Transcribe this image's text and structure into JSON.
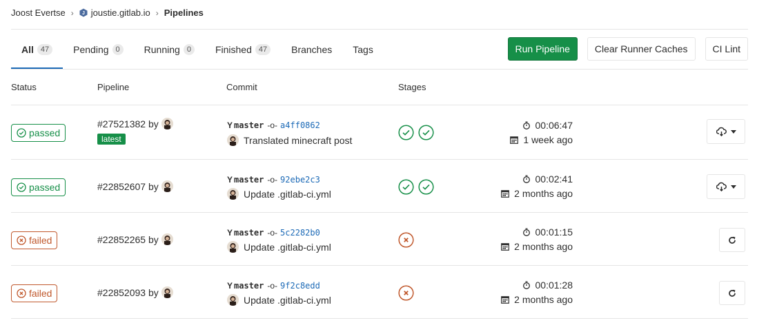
{
  "breadcrumb": {
    "user": "Joost Evertse",
    "project": "joustie.gitlab.io",
    "current": "Pipelines"
  },
  "tabs": [
    {
      "label": "All",
      "count": "47"
    },
    {
      "label": "Pending",
      "count": "0"
    },
    {
      "label": "Running",
      "count": "0"
    },
    {
      "label": "Finished",
      "count": "47"
    },
    {
      "label": "Branches"
    },
    {
      "label": "Tags"
    }
  ],
  "actions": {
    "run": "Run Pipeline",
    "clear": "Clear Runner Caches",
    "lint": "CI Lint"
  },
  "table": {
    "headers": [
      "Status",
      "Pipeline",
      "Commit",
      "Stages"
    ]
  },
  "rows": [
    {
      "status": "passed",
      "pipeline": "#27521382 by",
      "latest": "latest",
      "branch": "master",
      "sha": "a4ff0862",
      "message": "Translated minecraft post",
      "duration": "00:06:47",
      "finished": "1 week ago"
    },
    {
      "status": "passed",
      "pipeline": "#22852607 by",
      "branch": "master",
      "sha": "92ebe2c3",
      "message": "Update .gitlab-ci.yml",
      "duration": "00:02:41",
      "finished": "2 months ago"
    },
    {
      "status": "failed",
      "pipeline": "#22852265 by",
      "branch": "master",
      "sha": "5c2282b0",
      "message": "Update .gitlab-ci.yml",
      "duration": "00:01:15",
      "finished": "2 months ago"
    },
    {
      "status": "failed",
      "pipeline": "#22852093 by",
      "branch": "master",
      "sha": "9f2c8edd",
      "message": "Update .gitlab-ci.yml",
      "duration": "00:01:28",
      "finished": "2 months ago"
    }
  ],
  "colors": {
    "success": "#168f48",
    "failed": "#c0582c",
    "link": "#1b69b6"
  }
}
